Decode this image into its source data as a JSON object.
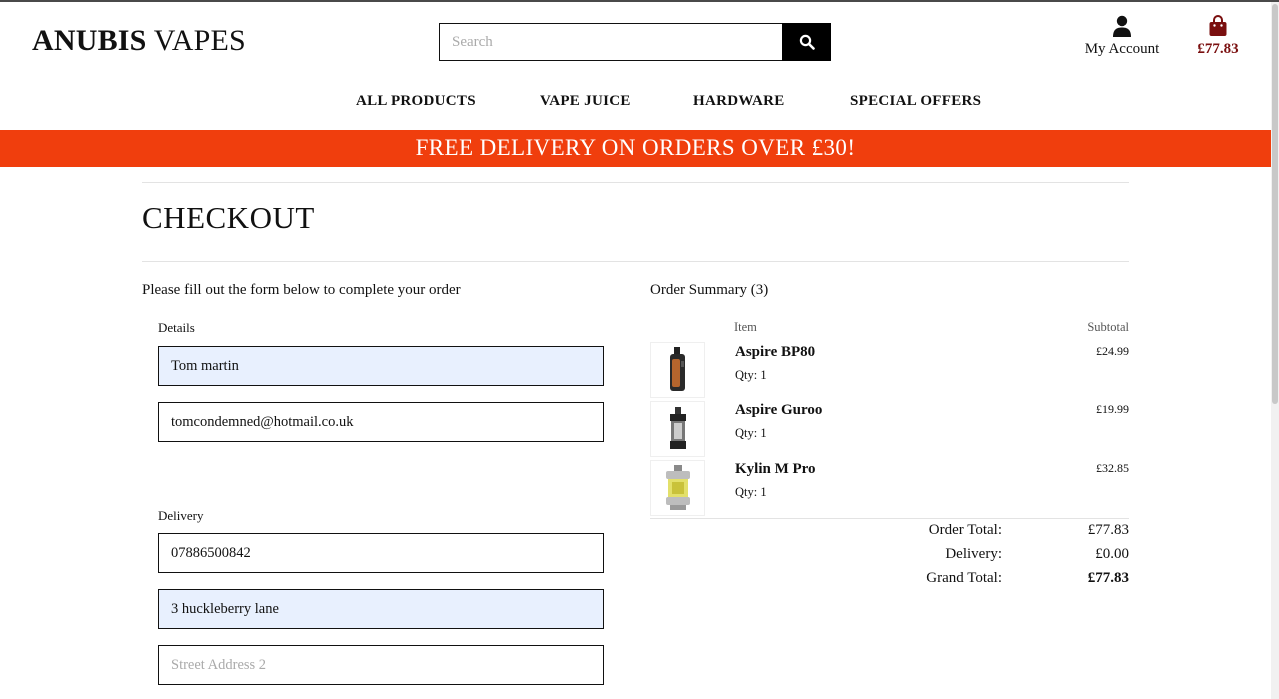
{
  "header": {
    "brand_part1": "ANUBIS",
    "brand_part2": "VAPES",
    "search_placeholder": "Search",
    "search_icon": "search-icon",
    "account_icon": "user-icon",
    "account_label": "My Account",
    "cart_icon": "shopping-bag-icon",
    "cart_total": "£77.83"
  },
  "nav": {
    "items": [
      {
        "label": "ALL PRODUCTS"
      },
      {
        "label": "VAPE JUICE"
      },
      {
        "label": "HARDWARE"
      },
      {
        "label": "SPECIAL OFFERS"
      }
    ]
  },
  "banner": {
    "text": "FREE DELIVERY ON ORDERS OVER £30!",
    "color": "#f03e0d"
  },
  "checkout": {
    "title": "CHECKOUT",
    "intro": "Please fill out the form below to complete your order",
    "details_label": "Details",
    "name_value": "Tom martin",
    "email_value": "tomcondemned@hotmail.co.uk",
    "delivery_label": "Delivery",
    "phone_value": "07886500842",
    "street1_value": "3 huckleberry lane",
    "street2_placeholder": "Street Address 2"
  },
  "summary": {
    "title": "Order Summary (3)",
    "col_item": "Item",
    "col_subtotal": "Subtotal",
    "items": [
      {
        "name": "Aspire BP80",
        "qty": "Qty: 1",
        "subtotal": "£24.99"
      },
      {
        "name": "Aspire Guroo",
        "qty": "Qty: 1",
        "subtotal": "£19.99"
      },
      {
        "name": "Kylin M Pro",
        "qty": "Qty: 1",
        "subtotal": "£32.85"
      }
    ],
    "order_total_label": "Order Total:",
    "order_total": "£77.83",
    "delivery_label": "Delivery:",
    "delivery": "£0.00",
    "grand_total_label": "Grand Total:",
    "grand_total": "£77.83"
  }
}
